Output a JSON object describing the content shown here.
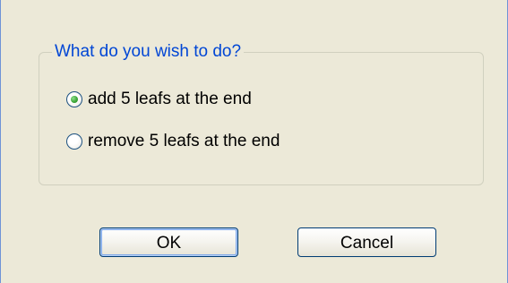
{
  "dialog": {
    "group_title": "What do you wish to do?",
    "options": [
      {
        "label": "add 5 leafs at the end",
        "selected": true
      },
      {
        "label": "remove 5 leafs at the end",
        "selected": false
      }
    ],
    "buttons": {
      "ok": "OK",
      "cancel": "Cancel"
    }
  },
  "colors": {
    "background": "#ece9d8",
    "group_title": "#0046d5",
    "selected_radio": "#3fa73a",
    "button_border": "#003c74"
  },
  "icons": {
    "selected_option": "radio-selected-icon",
    "unselected_option": "radio-unselected-icon"
  }
}
